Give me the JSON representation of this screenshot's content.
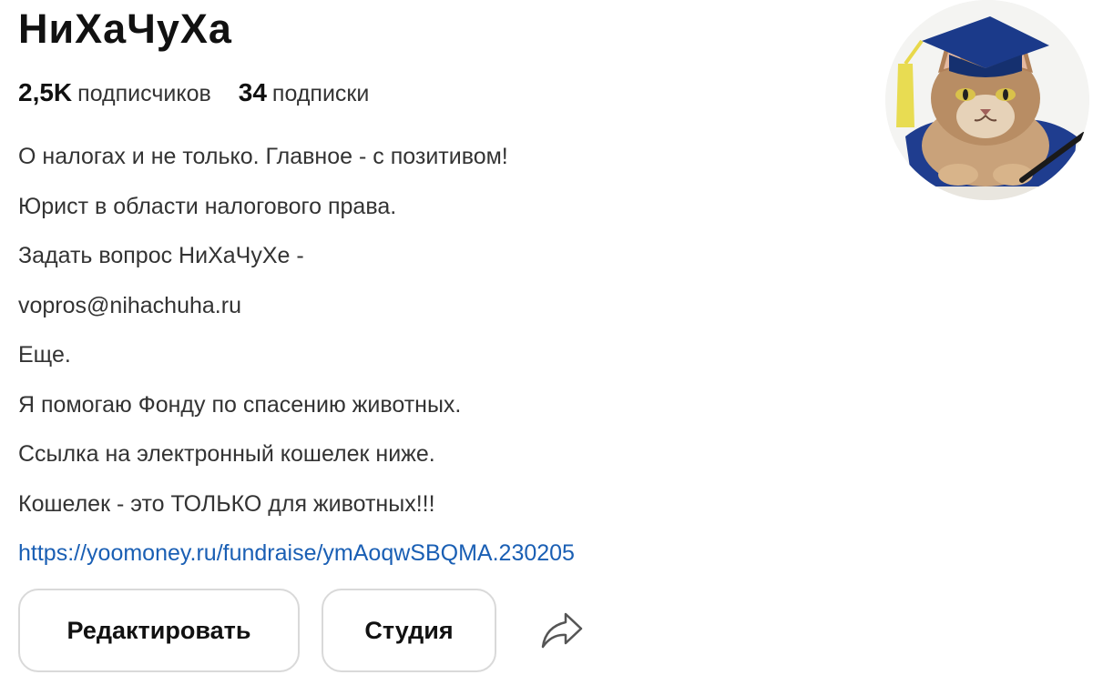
{
  "profile": {
    "name": "НиХаЧуХа",
    "followers_count": "2,5K",
    "followers_label": "подписчиков",
    "following_count": "34",
    "following_label": "подписки",
    "avatar_icon": "cat-graduate-avatar"
  },
  "bio": {
    "lines": [
      "О налогах и не только. Главное - с позитивом!",
      "Юрист в области налогового права.",
      "Задать вопрос НиХаЧуХе -",
      "vopros@nihachuha.ru",
      "Еще.",
      "Я помогаю Фонду по спасению животных.",
      "Ссылка на электронный кошелек ниже.",
      "Кошелек - это ТОЛЬКО для животных!!!"
    ],
    "link": "https://yoomoney.ru/fundraise/ymAoqwSBQMA.230205"
  },
  "actions": {
    "edit_label": "Редактировать",
    "studio_label": "Студия",
    "share_icon": "share-arrow-icon"
  },
  "colors": {
    "link": "#1a5fb4",
    "button_border": "#d9d9d9",
    "text": "#333333"
  }
}
